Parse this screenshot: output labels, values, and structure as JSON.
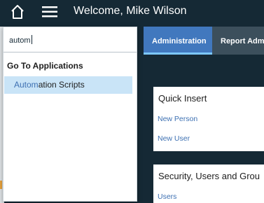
{
  "header": {
    "welcome_text": "Welcome, Mike Wilson",
    "home_icon": "home-icon",
    "menu_icon": "hamburger-menu-icon"
  },
  "search": {
    "value": "autom"
  },
  "search_results": {
    "group_label": "Go To Applications",
    "items": [
      {
        "label": "Automation Scripts",
        "match": "Autom",
        "rest": "ation Scripts",
        "highlighted": true
      }
    ]
  },
  "tabs": [
    {
      "label": "Administration",
      "active": true
    },
    {
      "label": "Report Adm",
      "active": false
    }
  ],
  "cards": {
    "quick_insert": {
      "title": "Quick Insert",
      "links": [
        "New Person",
        "New User"
      ]
    },
    "security": {
      "title": "Security, Users and Grou",
      "links": [
        "Users"
      ]
    }
  },
  "colors": {
    "header_bg": "#152935",
    "active_tab": "#4178be",
    "link": "#3d70b2",
    "highlight": "#c9e4f7"
  }
}
